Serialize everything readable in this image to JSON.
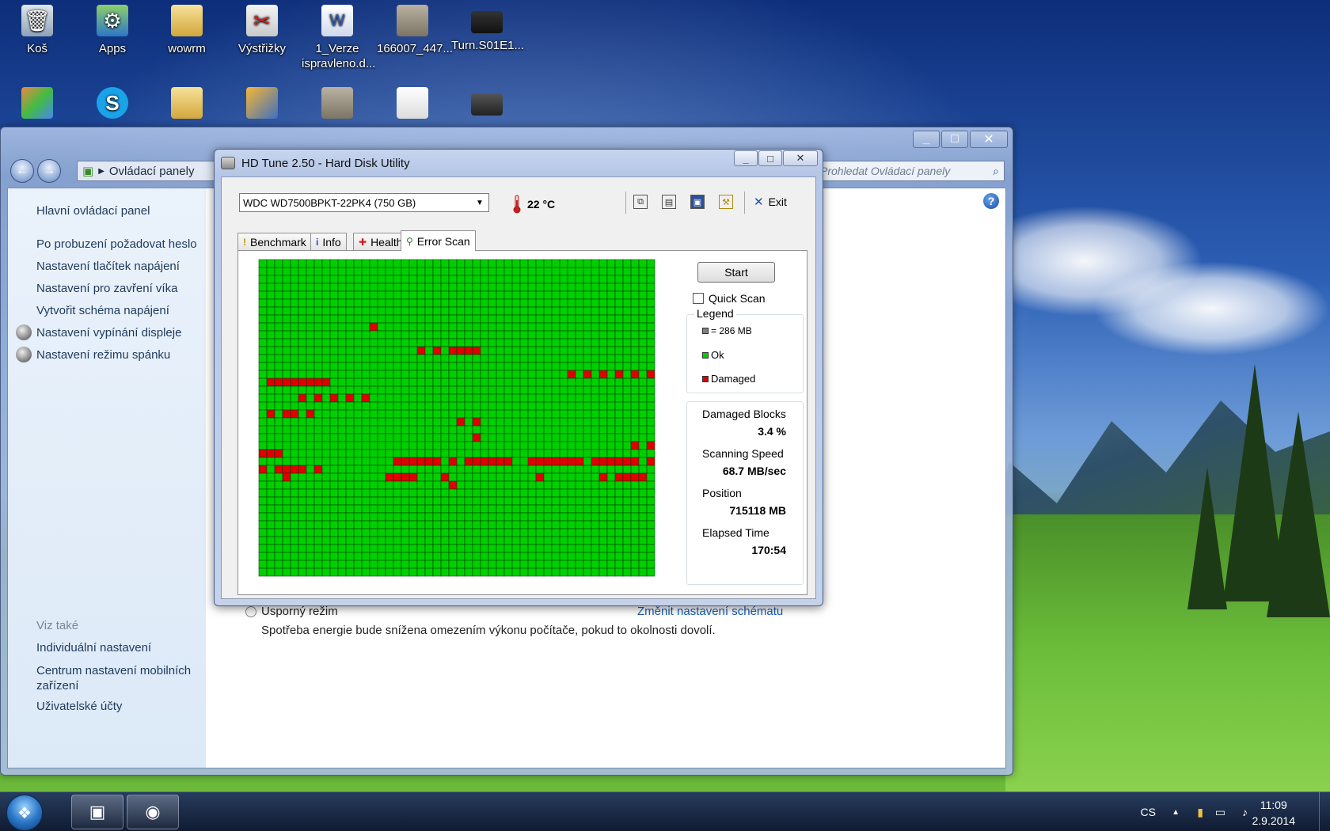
{
  "desktop": {
    "icons_row1": [
      {
        "label": "Koš",
        "icon": "recycle-bin-icon"
      },
      {
        "label": "Apps",
        "icon": "apps-shortcut-icon"
      },
      {
        "label": "wowrm",
        "icon": "folder-icon"
      },
      {
        "label": "Výstřižky",
        "icon": "snipping-tool-icon"
      },
      {
        "label": "1_Verze ispravleno.d...",
        "icon": "word-document-icon"
      },
      {
        "label": "166007_447...",
        "icon": "document-icon"
      },
      {
        "label": "Turn.S01E1...",
        "icon": "video-file-icon"
      }
    ],
    "icons_row2": [
      {
        "label": "",
        "icon": "app-shortcut-icon"
      },
      {
        "label": "",
        "icon": "skype-icon"
      },
      {
        "label": "",
        "icon": "folder-icon"
      },
      {
        "label": "",
        "icon": "program-shortcut-icon"
      },
      {
        "label": "",
        "icon": "document-icon"
      },
      {
        "label": "",
        "icon": "text-file-icon"
      },
      {
        "label": "",
        "icon": "video-file-icon"
      }
    ]
  },
  "control_panel": {
    "breadcrumb": "Ovládací panely",
    "search_placeholder": "Prohledat Ovládací panely",
    "sidebar": {
      "home": "Hlavní ovládací panel",
      "links": [
        "Po probuzení požadovat heslo",
        "Nastavení tlačítek napájení",
        "Nastavení pro zavření víka",
        "Vytvořit schéma napájení",
        "Nastavení vypínání displeje",
        "Nastavení režimu spánku"
      ],
      "see_also_title": "Viz také",
      "see_also": [
        "Individuální nastavení",
        "Centrum nastavení mobilních zařízení",
        "Uživatelské účty"
      ]
    },
    "main": {
      "plan_name": "Úsporný režim",
      "plan_link": "Změnit nastavení schématu",
      "plan_description": "Spotřeba energie bude snížena omezením výkonu počítače, pokud to okolnosti dovolí."
    }
  },
  "hdtune": {
    "title": "HD Tune 2.50 - Hard Disk Utility",
    "drive": "WDC WD7500BPKT-22PK4 (750 GB)",
    "temperature": "22 °C",
    "exit_label": "Exit",
    "tabs": [
      {
        "label": "Benchmark",
        "icon": "benchmark-icon"
      },
      {
        "label": "Info",
        "icon": "info-icon"
      },
      {
        "label": "Health",
        "icon": "health-icon"
      },
      {
        "label": "Error Scan",
        "icon": "error-scan-icon",
        "active": true
      }
    ],
    "start_label": "Start",
    "quick_scan_label": "Quick Scan",
    "quick_scan_checked": false,
    "legend": {
      "title": "Legend",
      "block_size": "= 286 MB",
      "ok": "Ok",
      "damaged": "Damaged"
    },
    "colors": {
      "ok": "#00d000",
      "damaged": "#e00000",
      "block": "#808080"
    },
    "stats": {
      "damaged_blocks_label": "Damaged Blocks",
      "damaged_blocks_value": "3.4 %",
      "scanning_speed_label": "Scanning Speed",
      "scanning_speed_value": "68.7 MB/sec",
      "position_label": "Position",
      "position_value": "715118 MB",
      "elapsed_label": "Elapsed Time",
      "elapsed_value": "170:54"
    },
    "grid": {
      "cols": 50,
      "rows": 40,
      "damaged_cells": [
        [
          8,
          14
        ],
        [
          11,
          20
        ],
        [
          11,
          22
        ],
        [
          11,
          24
        ],
        [
          11,
          25
        ],
        [
          11,
          26
        ],
        [
          11,
          27
        ],
        [
          14,
          39
        ],
        [
          14,
          41
        ],
        [
          14,
          43
        ],
        [
          14,
          45
        ],
        [
          14,
          47
        ],
        [
          14,
          49
        ],
        [
          15,
          1
        ],
        [
          15,
          2
        ],
        [
          15,
          3
        ],
        [
          15,
          4
        ],
        [
          15,
          5
        ],
        [
          15,
          6
        ],
        [
          15,
          7
        ],
        [
          15,
          8
        ],
        [
          17,
          5
        ],
        [
          17,
          7
        ],
        [
          17,
          9
        ],
        [
          17,
          11
        ],
        [
          17,
          13
        ],
        [
          19,
          1
        ],
        [
          19,
          3
        ],
        [
          19,
          4
        ],
        [
          19,
          6
        ],
        [
          20,
          25
        ],
        [
          20,
          27
        ],
        [
          22,
          27
        ],
        [
          23,
          47
        ],
        [
          23,
          49
        ],
        [
          24,
          0
        ],
        [
          24,
          1
        ],
        [
          24,
          2
        ],
        [
          25,
          17
        ],
        [
          25,
          18
        ],
        [
          25,
          19
        ],
        [
          25,
          20
        ],
        [
          25,
          21
        ],
        [
          25,
          22
        ],
        [
          25,
          24
        ],
        [
          25,
          26
        ],
        [
          25,
          27
        ],
        [
          25,
          28
        ],
        [
          25,
          29
        ],
        [
          25,
          30
        ],
        [
          25,
          31
        ],
        [
          25,
          34
        ],
        [
          25,
          35
        ],
        [
          25,
          36
        ],
        [
          25,
          37
        ],
        [
          25,
          38
        ],
        [
          25,
          39
        ],
        [
          25,
          40
        ],
        [
          25,
          42
        ],
        [
          25,
          43
        ],
        [
          25,
          44
        ],
        [
          25,
          45
        ],
        [
          25,
          46
        ],
        [
          25,
          47
        ],
        [
          25,
          49
        ],
        [
          26,
          0
        ],
        [
          26,
          2
        ],
        [
          26,
          3
        ],
        [
          26,
          4
        ],
        [
          26,
          5
        ],
        [
          26,
          7
        ],
        [
          27,
          3
        ],
        [
          27,
          16
        ],
        [
          27,
          17
        ],
        [
          27,
          18
        ],
        [
          27,
          19
        ],
        [
          27,
          23
        ],
        [
          27,
          35
        ],
        [
          27,
          43
        ],
        [
          27,
          45
        ],
        [
          27,
          46
        ],
        [
          27,
          47
        ],
        [
          27,
          48
        ],
        [
          28,
          24
        ]
      ]
    }
  },
  "taskbar": {
    "language": "CS",
    "time": "11:09",
    "date": "2.9.2014",
    "pinned": [
      {
        "name": "control-panel",
        "icon": "control-panel-icon"
      },
      {
        "name": "hdtune",
        "icon": "hdtune-icon"
      }
    ]
  }
}
